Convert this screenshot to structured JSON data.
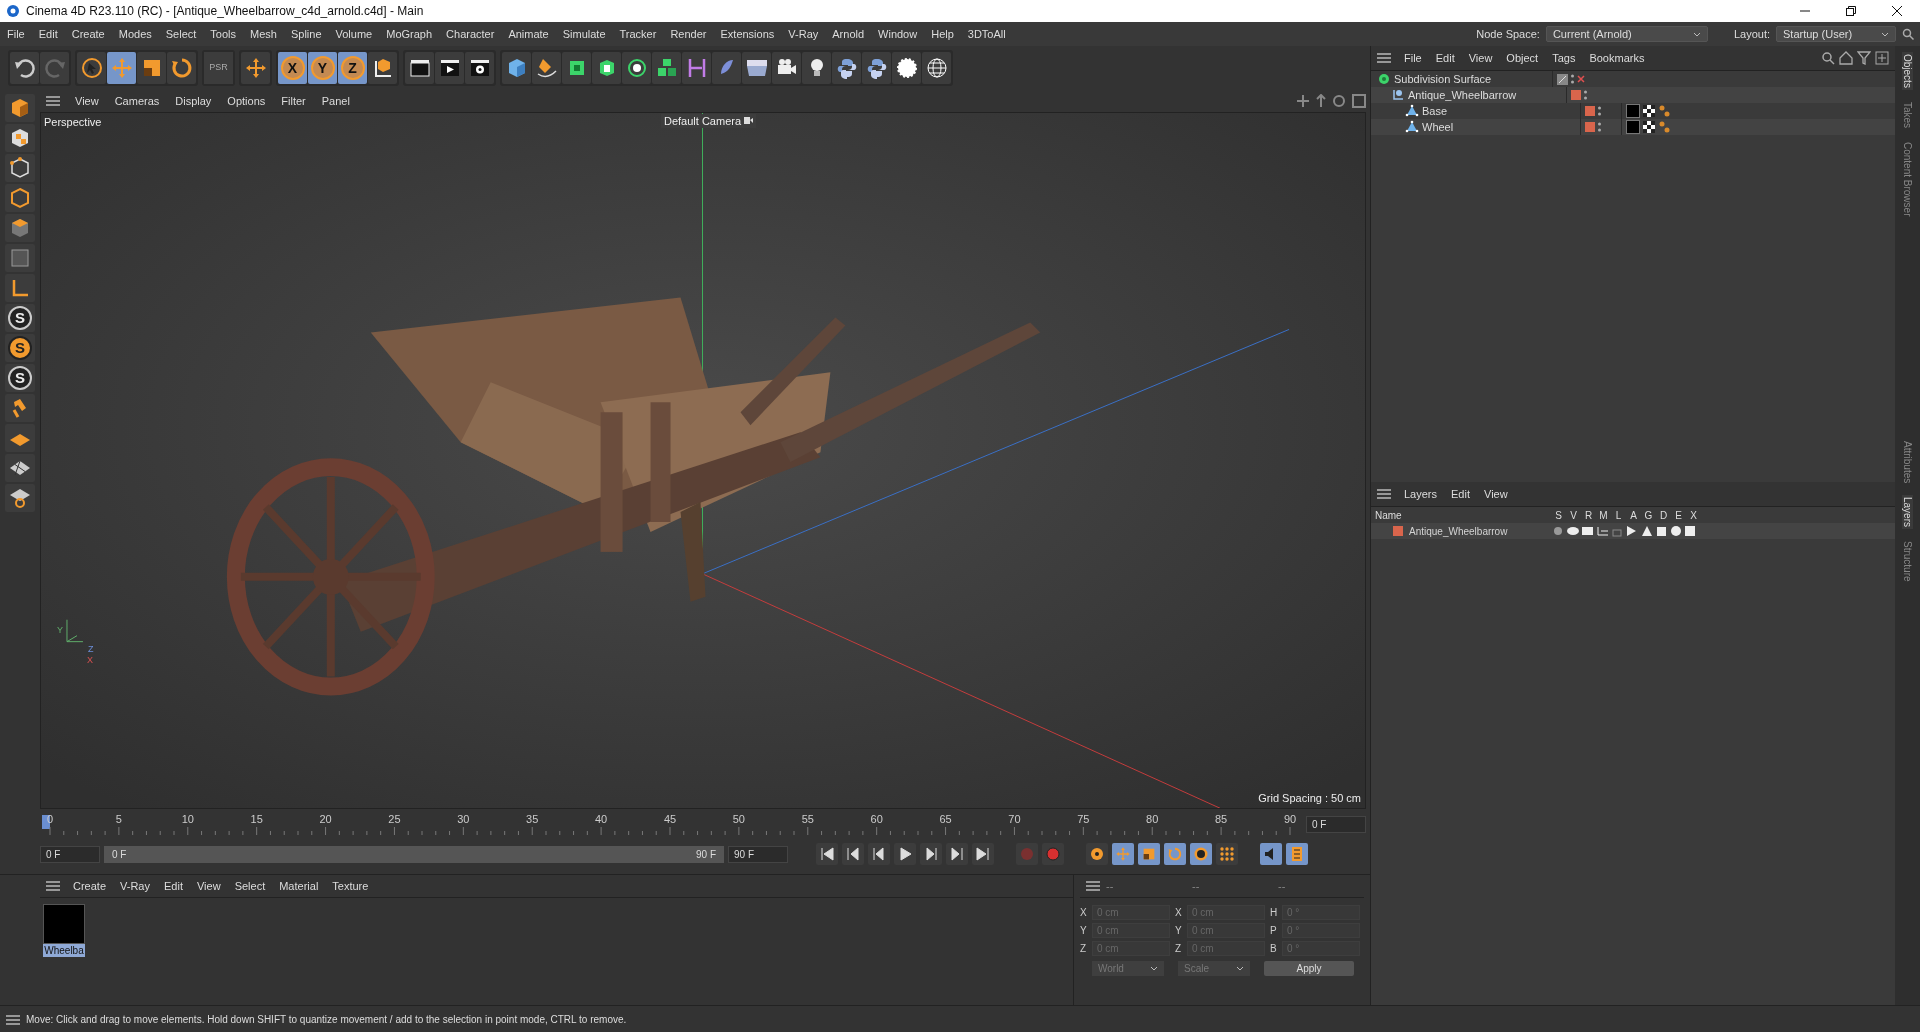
{
  "window": {
    "title": "Cinema 4D R23.110 (RC) - [Antique_Wheelbarrow_c4d_arnold.c4d] - Main"
  },
  "menu_bar": [
    "File",
    "Edit",
    "Create",
    "Modes",
    "Select",
    "Tools",
    "Mesh",
    "Spline",
    "Volume",
    "MoGraph",
    "Character",
    "Animate",
    "Simulate",
    "Tracker",
    "Render",
    "Extensions",
    "V-Ray",
    "Arnold",
    "Window",
    "Help",
    "3DToAll"
  ],
  "node_space": {
    "label": "Node Space:",
    "value": "Current (Arnold)"
  },
  "layout": {
    "label": "Layout:",
    "value": "Startup (User)"
  },
  "toolbar": {
    "tools": [
      {
        "kind": "select",
        "selected": false
      },
      {
        "kind": "move",
        "selected": true
      },
      {
        "kind": "scale",
        "selected": false
      },
      {
        "kind": "rotate",
        "selected": false
      }
    ],
    "psr_label": "PSR",
    "axis_buttons": [
      {
        "label": "X",
        "selected": true
      },
      {
        "label": "Y",
        "selected": true
      },
      {
        "label": "Z",
        "selected": true
      }
    ]
  },
  "left_tools": {
    "s_buttons": [
      "S",
      "S",
      "S"
    ]
  },
  "viewport": {
    "menu": [
      "View",
      "Cameras",
      "Display",
      "Options",
      "Filter",
      "Panel"
    ],
    "view_name": "Perspective",
    "camera": "Default Camera",
    "grid_spacing": "Grid Spacing : 50 cm",
    "axis_labels": [
      "Y",
      "Z",
      "X"
    ]
  },
  "timeline": {
    "ticks": [
      "0",
      "5",
      "10",
      "15",
      "20",
      "25",
      "30",
      "35",
      "40",
      "45",
      "50",
      "55",
      "60",
      "65",
      "70",
      "75",
      "80",
      "85",
      "90"
    ],
    "current_frame": "0 F",
    "start_field": "0 F",
    "range_start": "0 F",
    "range_end": "90 F",
    "range": {
      "level": 1
    },
    "end_field": "90 F",
    "auto_key_on": false
  },
  "objects": {
    "menu": [
      "File",
      "Edit",
      "View",
      "Object",
      "Tags",
      "Bookmarks"
    ],
    "tree": [
      {
        "name": "Subdivision Surface",
        "kind": "generator",
        "children": [
          {
            "name": "Antique_Wheelbarrow",
            "kind": "null",
            "children": [
              {
                "name": "Base",
                "kind": "polygon"
              },
              {
                "name": "Wheel",
                "kind": "polygon"
              }
            ]
          }
        ]
      }
    ]
  },
  "layers": {
    "menu": [
      "Layers",
      "Edit",
      "View"
    ],
    "columns": [
      "Name",
      "S",
      "V",
      "R",
      "M",
      "L",
      "A",
      "G",
      "D",
      "E",
      "X"
    ],
    "rows": [
      {
        "name": "Antique_Wheelbarrow",
        "color": "#d9654c"
      }
    ]
  },
  "materials": {
    "menu": [
      "Create",
      "V-Ray",
      "Edit",
      "View",
      "Select",
      "Material",
      "Texture"
    ],
    "items": [
      {
        "name": "Wheelba",
        "selected": true
      }
    ]
  },
  "coordinates": {
    "headers": [
      "--",
      "--",
      "--"
    ],
    "rows": [
      {
        "labels": [
          "X",
          "X",
          "H"
        ],
        "values": [
          "0 cm",
          "0 cm",
          "0 °"
        ]
      },
      {
        "labels": [
          "Y",
          "Y",
          "P"
        ],
        "values": [
          "0 cm",
          "0 cm",
          "0 °"
        ]
      },
      {
        "labels": [
          "Z",
          "Z",
          "B"
        ],
        "values": [
          "0 cm",
          "0 cm",
          "0 °"
        ]
      }
    ],
    "dropdowns": [
      "World",
      "Scale"
    ],
    "apply": "Apply"
  },
  "side_tabs": [
    {
      "label": "Objects",
      "selected": true
    },
    {
      "label": "Takes",
      "selected": false
    },
    {
      "label": "Content Browser",
      "selected": false
    },
    {
      "label": "Attributes",
      "selected": false
    },
    {
      "label": "Layers",
      "selected": true
    },
    {
      "label": "Structure",
      "selected": false
    }
  ],
  "status_bar": "Move: Click and drag to move elements. Hold down SHIFT to quantize movement / add to the selection in point mode, CTRL to remove."
}
